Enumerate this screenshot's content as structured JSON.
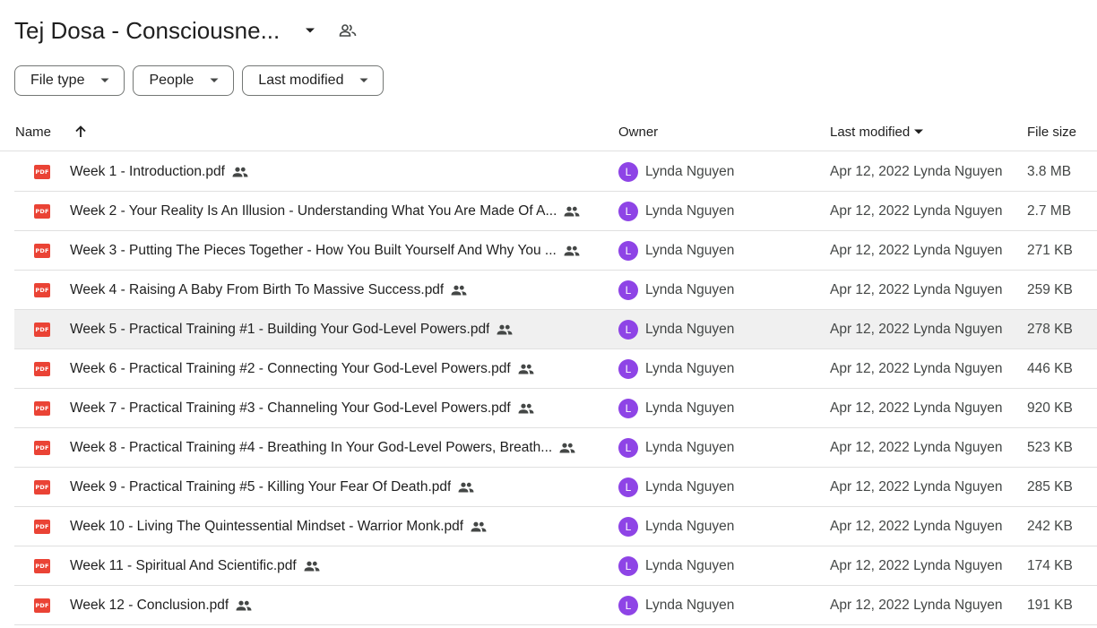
{
  "header": {
    "title": "Tej Dosa - Consciousne...",
    "title_dropdown_icon": "arrow-drop-down-icon",
    "shared_icon": "shared-people-icon"
  },
  "filters": [
    {
      "label": "File type"
    },
    {
      "label": "People"
    },
    {
      "label": "Last modified"
    }
  ],
  "table": {
    "columns": {
      "name": "Name",
      "owner": "Owner",
      "last_modified": "Last modified",
      "file_size": "File size"
    },
    "rows": [
      {
        "name": "Week 1 - Introduction.pdf",
        "owner_initial": "L",
        "owner": "Lynda Nguyen",
        "modified": "Apr 12, 2022 Lynda Nguyen",
        "size": "3.8 MB"
      },
      {
        "name": "Week 2 - Your Reality Is An Illusion - Understanding What You Are Made Of A...",
        "owner_initial": "L",
        "owner": "Lynda Nguyen",
        "modified": "Apr 12, 2022 Lynda Nguyen",
        "size": "2.7 MB"
      },
      {
        "name": "Week 3 - Putting The Pieces Together - How You Built Yourself And Why You ...",
        "owner_initial": "L",
        "owner": "Lynda Nguyen",
        "modified": "Apr 12, 2022 Lynda Nguyen",
        "size": "271 KB"
      },
      {
        "name": "Week 4 - Raising A Baby From Birth To Massive Success.pdf",
        "owner_initial": "L",
        "owner": "Lynda Nguyen",
        "modified": "Apr 12, 2022 Lynda Nguyen",
        "size": "259 KB"
      },
      {
        "name": "Week 5 - Practical Training #1 - Building Your God-Level Powers.pdf",
        "owner_initial": "L",
        "owner": "Lynda Nguyen",
        "modified": "Apr 12, 2022 Lynda Nguyen",
        "size": "278 KB",
        "highlighted": true
      },
      {
        "name": "Week 6 - Practical Training #2 - Connecting Your God-Level Powers.pdf",
        "owner_initial": "L",
        "owner": "Lynda Nguyen",
        "modified": "Apr 12, 2022 Lynda Nguyen",
        "size": "446 KB"
      },
      {
        "name": "Week 7 - Practical Training #3 - Channeling Your God-Level Powers.pdf",
        "owner_initial": "L",
        "owner": "Lynda Nguyen",
        "modified": "Apr 12, 2022 Lynda Nguyen",
        "size": "920 KB"
      },
      {
        "name": "Week 8 - Practical Training #4 - Breathing In Your God-Level Powers, Breath...",
        "owner_initial": "L",
        "owner": "Lynda Nguyen",
        "modified": "Apr 12, 2022 Lynda Nguyen",
        "size": "523 KB"
      },
      {
        "name": "Week 9 - Practical Training #5 - Killing Your Fear Of Death.pdf",
        "owner_initial": "L",
        "owner": "Lynda Nguyen",
        "modified": "Apr 12, 2022 Lynda Nguyen",
        "size": "285 KB"
      },
      {
        "name": "Week 10 - Living The Quintessential Mindset - Warrior Monk.pdf",
        "owner_initial": "L",
        "owner": "Lynda Nguyen",
        "modified": "Apr 12, 2022 Lynda Nguyen",
        "size": "242 KB"
      },
      {
        "name": "Week 11 - Spiritual And Scientific.pdf",
        "owner_initial": "L",
        "owner": "Lynda Nguyen",
        "modified": "Apr 12, 2022 Lynda Nguyen",
        "size": "174 KB"
      },
      {
        "name": "Week 12 - Conclusion.pdf",
        "owner_initial": "L",
        "owner": "Lynda Nguyen",
        "modified": "Apr 12, 2022 Lynda Nguyen",
        "size": "191 KB"
      }
    ]
  },
  "icons": {
    "file_type": "pdf-file-icon",
    "pdf_text": "PDF",
    "shared": "shared-people-icon",
    "sort": "arrow-upward-icon",
    "sort_dir": "arrow-drop-down-icon"
  },
  "colors": {
    "pdf_red": "#ea4335",
    "avatar_purple": "#8e44e6",
    "row_highlight": "#f0f0f0",
    "divider": "#e0e0e0"
  }
}
